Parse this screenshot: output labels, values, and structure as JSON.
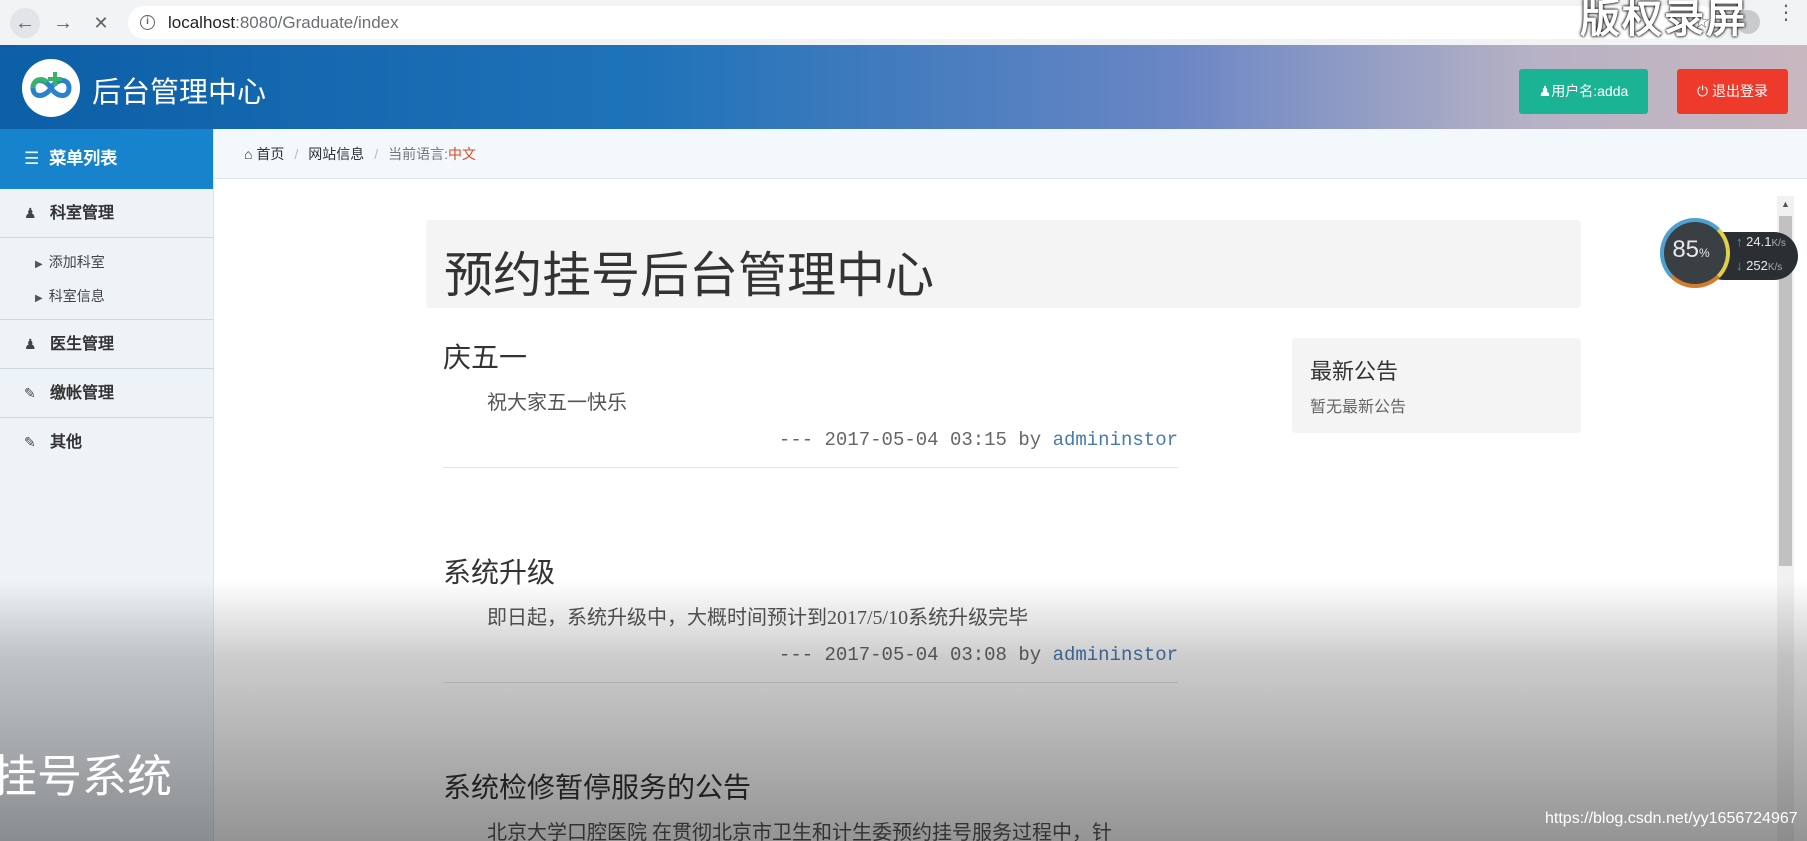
{
  "browser": {
    "url_host": "localhost",
    "url_path": ":8080/Graduate/index",
    "overlay_text": "版权录屏"
  },
  "header": {
    "title": "后台管理中心",
    "user_button": "用户名:adda",
    "logout_button": "退出登录"
  },
  "sidebar": {
    "heading": "菜单列表",
    "groups": [
      {
        "label": "科室管理",
        "items": [
          "添加科室",
          "科室信息"
        ]
      },
      {
        "label": "医生管理"
      },
      {
        "label": "缴帐管理"
      },
      {
        "label": "其他"
      }
    ]
  },
  "breadcrumb": {
    "home": "首页",
    "site_info": "网站信息",
    "lang_label": "当前语言:",
    "lang_value": "中文"
  },
  "main": {
    "jumbotron_title": "预约挂号后台管理中心",
    "posts": [
      {
        "title": "庆五一",
        "body": "祝大家五一快乐",
        "meta_prefix": "--- 2017-05-04 03:15 by ",
        "author": "admininstor"
      },
      {
        "title": "系统升级",
        "body": "即日起，系统升级中，大概时间预计到2017/5/10系统升级完毕",
        "meta_prefix": "--- 2017-05-04 03:08 by ",
        "author": "admininstor"
      },
      {
        "title": "系统检修暂停服务的公告",
        "body": "北京大学口腔医院 在贯彻北京市卫生和计生委预约挂号服务过程中，针"
      }
    ],
    "notice": {
      "title": "最新公告",
      "text": "暂无最新公告"
    }
  },
  "speed_widget": {
    "percent": "85",
    "percent_unit": "%",
    "upload": "24.1",
    "download": "252",
    "unit": "K/s"
  },
  "overlay": {
    "left_text": "挂号系统",
    "watermark": "https://blog.csdn.net/yy1656724967"
  },
  "colors": {
    "user_button": "#1ab394",
    "logout_button": "#ed3a2b",
    "sidebar_head": "#1783cd",
    "link": "#4779b4",
    "lang": "#d94c22"
  }
}
